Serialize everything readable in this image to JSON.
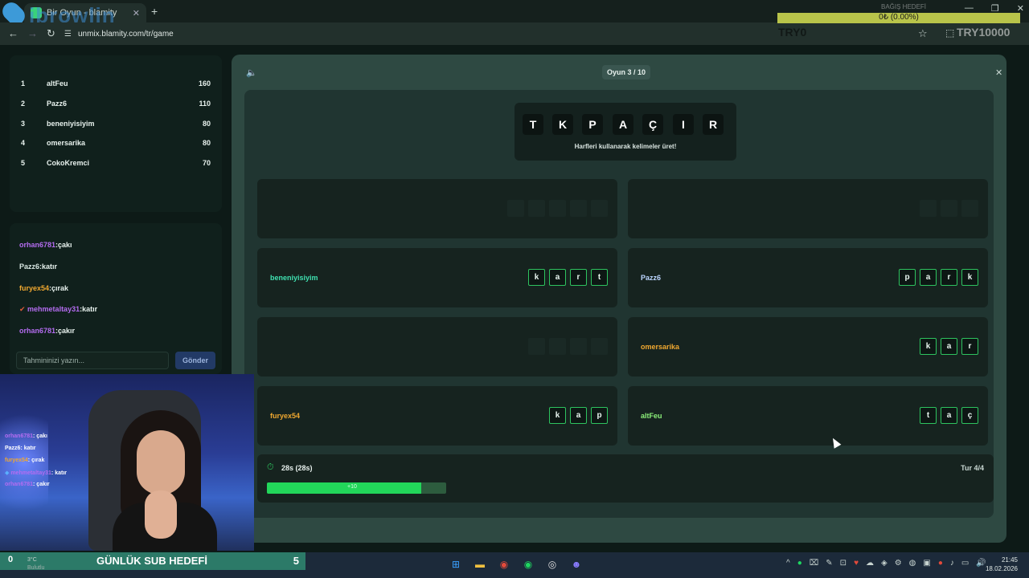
{
  "browser": {
    "tab_title": "Bir Oyun - blamity",
    "url": "unmix.blamity.com/tr/game",
    "logo_text": "ibrowlin"
  },
  "overlay": {
    "donation_label": "BAĞIŞ HEDEFİ",
    "donation_progress": "0₺ (0.00%)",
    "donation_progress_fraction": 0.0,
    "donation_min": "TRY0",
    "donation_max": "TRY10000"
  },
  "leaderboard": [
    {
      "rank": "1",
      "name": "altFeu",
      "points": "160"
    },
    {
      "rank": "2",
      "name": "Pazz6",
      "points": "110"
    },
    {
      "rank": "3",
      "name": "beneniyisiyim",
      "points": "80"
    },
    {
      "rank": "4",
      "name": "omersarika",
      "points": "80"
    },
    {
      "rank": "5",
      "name": "CokoKremci",
      "points": "70"
    }
  ],
  "chat": {
    "messages": [
      {
        "user": "orhan6781",
        "text": ":çakı",
        "color": "#b46cf0"
      },
      {
        "user": "Pazz6",
        "text": ":katır",
        "color": "#d8e6e2"
      },
      {
        "user": "furyex54",
        "text": ":çırak",
        "color": "#f0a830"
      },
      {
        "user": "mehmetaltay31",
        "text": ":katır",
        "color": "#b46cf0"
      },
      {
        "user": "orhan6781",
        "text": ":çakır",
        "color": "#b46cf0"
      }
    ],
    "input_placeholder": "Tahmininizi yazın...",
    "send_label": "Gönder"
  },
  "webcam_chat": [
    {
      "user": "orhan6781",
      "text": ": çakı",
      "color": "#b46cf0"
    },
    {
      "user": "Pazz6",
      "text": ": katır",
      "color": "#ffffff"
    },
    {
      "user": "furyex54",
      "text": ": çırak",
      "color": "#f0a830"
    },
    {
      "user": "mehmetaltay31",
      "text": ": katır",
      "color": "#b46cf0"
    },
    {
      "user": "orhan6781",
      "text": ": çakır",
      "color": "#b46cf0"
    }
  ],
  "game": {
    "round_label": "Oyun 3 / 10",
    "letters": [
      "T",
      "K",
      "P",
      "A",
      "Ç",
      "I",
      "R"
    ],
    "hint": "Harfleri kullanarak kelimeler üret!",
    "cards": [
      {
        "name": "",
        "name_color": "#ffffff",
        "letters": [],
        "empty_slots": 5
      },
      {
        "name": "",
        "name_color": "#ffffff",
        "letters": [],
        "empty_slots": 3
      },
      {
        "name": "beneniyisiyim",
        "name_color": "#3fe0b0",
        "letters": [
          "k",
          "a",
          "r",
          "t"
        ],
        "empty_slots": 0
      },
      {
        "name": "Pazz6",
        "name_color": "#bcd6ff",
        "letters": [
          "p",
          "a",
          "r",
          "k"
        ],
        "empty_slots": 0
      },
      {
        "name": "",
        "name_color": "#ffffff",
        "letters": [],
        "empty_slots": 4
      },
      {
        "name": "omersarika",
        "name_color": "#f0a830",
        "letters": [
          "k",
          "a",
          "r"
        ],
        "empty_slots": 0
      },
      {
        "name": "furyex54",
        "name_color": "#f0a830",
        "letters": [
          "k",
          "a",
          "p"
        ],
        "empty_slots": 0
      },
      {
        "name": "altFeu",
        "name_color": "#8cf07a",
        "letters": [
          "t",
          "a",
          "ç"
        ],
        "empty_slots": 0
      }
    ],
    "timer_text": "28s (28s)",
    "turn_text": "Tur 4/4",
    "progress_fraction": 0.86,
    "progress_label": "+10"
  },
  "taskbar": {
    "sub_goal_label": "GÜNLÜK SUB HEDEFİ",
    "sub_goal_left": "0",
    "sub_goal_value": "5",
    "weather_temp": "3°C",
    "weather_desc": "Bulutlu",
    "time": "21:45",
    "date": "18.02.2026"
  }
}
